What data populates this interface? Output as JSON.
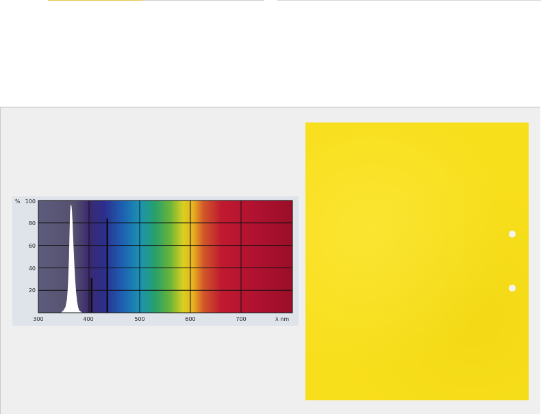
{
  "chart_data": {
    "type": "area",
    "title": "",
    "ylabel": "%",
    "xlabel": "λ nm",
    "xlim": [
      300,
      700
    ],
    "ylim": [
      0,
      100
    ],
    "x_ticks": [
      "300",
      "400",
      "500",
      "600",
      "700"
    ],
    "y_ticks": [
      "20",
      "40",
      "60",
      "80",
      "100"
    ],
    "grid": true,
    "series": [
      {
        "x": [
          345,
          350,
          354,
          357,
          359,
          361,
          362,
          363,
          364,
          365,
          366,
          367,
          368,
          370,
          372,
          374,
          376,
          378,
          380,
          383,
          386
        ],
        "y": [
          0,
          2,
          5,
          12,
          25,
          48,
          70,
          88,
          96,
          95,
          90,
          80,
          68,
          48,
          30,
          18,
          10,
          5,
          2,
          1,
          0
        ]
      }
    ],
    "lines": [
      {
        "x": 405,
        "y": 31
      },
      {
        "x": 436,
        "y": 84
      }
    ]
  },
  "colors": {
    "panel_bg": "#efefef",
    "card_yellow": "#f8df1c",
    "uv_region": "#5a5a78",
    "curve_fill": "#ffffff",
    "grid": "#111111"
  }
}
